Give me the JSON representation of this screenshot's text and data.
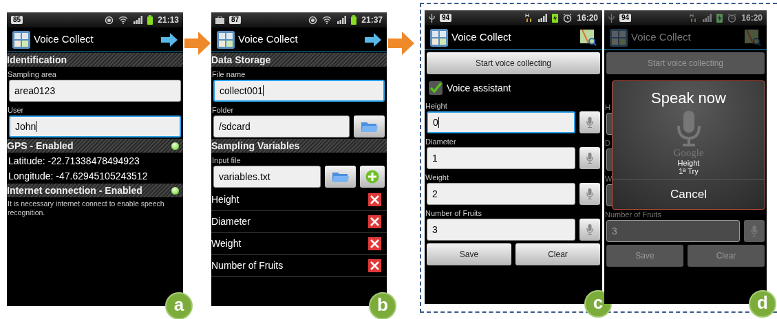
{
  "screens": [
    {
      "tag": "a",
      "dimmed": false,
      "status_bar": {
        "kind": "wifi",
        "badge": "85",
        "time": "21:13"
      },
      "app_bar": {
        "title": "Voice Collect",
        "kind": "next"
      },
      "items": [
        {
          "kind": "header",
          "text": "Identification"
        },
        {
          "kind": "label",
          "text": "Sampling area"
        },
        {
          "kind": "field",
          "value": "area0123",
          "focused": false
        },
        {
          "kind": "label",
          "text": "User"
        },
        {
          "kind": "field",
          "value": "John",
          "focused": true
        },
        {
          "kind": "header",
          "text": "GPS - Enabled",
          "on": true
        },
        {
          "kind": "text",
          "text": "Latitude: -22.71338478494923"
        },
        {
          "kind": "text",
          "text": "Longitude: -47.62945105243512"
        },
        {
          "kind": "header",
          "text": "Internet connection - Enabled",
          "on": true
        },
        {
          "kind": "note",
          "text": "It is necessary internet connect to enable speech recognition."
        }
      ]
    },
    {
      "tag": "b",
      "dimmed": false,
      "status_bar": {
        "kind": "briefcase",
        "badge": "87",
        "time": "21:37"
      },
      "app_bar": {
        "title": "Voice Collect",
        "kind": "next"
      },
      "items": [
        {
          "kind": "header",
          "text": "Data Storage"
        },
        {
          "kind": "label",
          "text": "File name"
        },
        {
          "kind": "field",
          "value": "collect001",
          "focused": true
        },
        {
          "kind": "label",
          "text": "Folder"
        },
        {
          "kind": "field",
          "value": "/sdcard",
          "focused": false,
          "folder_button": true,
          "add_button": false
        },
        {
          "kind": "header",
          "text": "Sampling Variables"
        },
        {
          "kind": "label",
          "text": "Input file"
        },
        {
          "kind": "field",
          "value": "variables.txt",
          "focused": false,
          "folder_button": true,
          "add_button": true
        },
        {
          "kind": "list_item",
          "text": "Height"
        },
        {
          "kind": "list_item",
          "text": "Diameter"
        },
        {
          "kind": "list_item",
          "text": "Weight"
        },
        {
          "kind": "list_item",
          "text": "Number of Fruits"
        }
      ]
    },
    {
      "tag": "c",
      "dimmed": false,
      "status_bar": {
        "kind": "usb",
        "badge": "94",
        "time": "16:20"
      },
      "app_bar": {
        "title": "Voice Collect",
        "kind": "map"
      },
      "items": [
        {
          "kind": "button",
          "text": "Start voice collecting"
        },
        {
          "kind": "checkbox",
          "text": "Voice assistant",
          "checked": true
        },
        {
          "kind": "label",
          "text": "Height"
        },
        {
          "kind": "field",
          "value": "0",
          "focused": true,
          "mic_button": true
        },
        {
          "kind": "label",
          "text": "Diameter"
        },
        {
          "kind": "field",
          "value": "1",
          "focused": false,
          "mic_button": true
        },
        {
          "kind": "label",
          "text": "Weight"
        },
        {
          "kind": "field",
          "value": "2",
          "focused": false,
          "mic_button": true
        },
        {
          "kind": "label",
          "text": "Number of Fruits"
        },
        {
          "kind": "field",
          "value": "3",
          "focused": false,
          "mic_button": true
        },
        {
          "kind": "buttons",
          "labels": [
            "Save",
            "Clear"
          ]
        }
      ]
    },
    {
      "tag": "d",
      "dimmed": true,
      "status_bar": {
        "kind": "usb",
        "badge": "94",
        "time": "16:20"
      },
      "app_bar": {
        "title": "Voice Collect",
        "kind": "map"
      },
      "items": [
        {
          "kind": "button",
          "text": "Start voice collecting"
        },
        {
          "kind": "spacer"
        },
        {
          "kind": "label",
          "text": "H"
        },
        {
          "kind": "field",
          "value": "",
          "focused": false
        },
        {
          "kind": "label",
          "text": "D"
        },
        {
          "kind": "field",
          "value": "",
          "focused": false
        },
        {
          "kind": "label",
          "text": "W"
        },
        {
          "kind": "field",
          "value": "",
          "focused": false
        },
        {
          "kind": "label",
          "text": "Number of Fruits"
        },
        {
          "kind": "field",
          "value": "3",
          "focused": false,
          "mic_button": true
        },
        {
          "kind": "buttons",
          "labels": [
            "Save",
            "Clear"
          ]
        }
      ],
      "dialog": {
        "title": "Speak now",
        "brand": "Google",
        "lines": [
          "Height",
          "1ª Try"
        ],
        "cancel": "Cancel"
      }
    }
  ]
}
